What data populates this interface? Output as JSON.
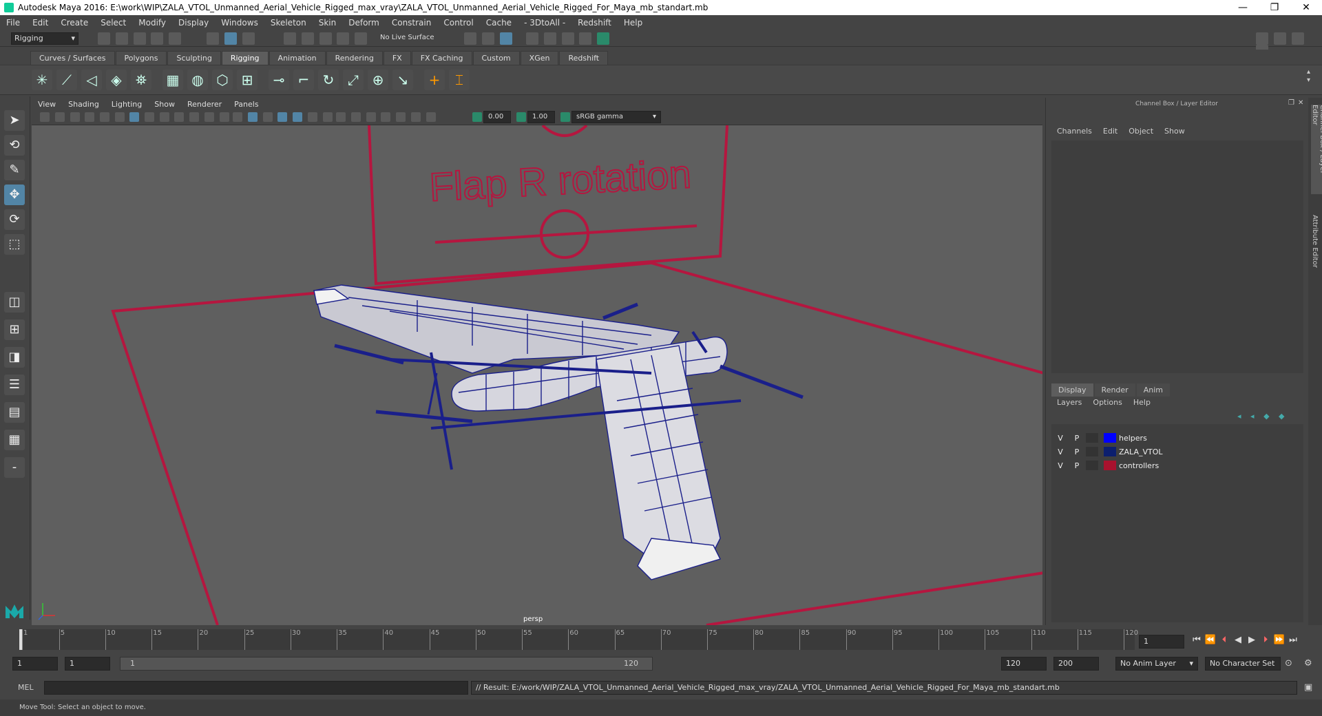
{
  "window": {
    "title": "Autodesk Maya 2016: E:\\work\\WIP\\ZALA_VTOL_Unmanned_Aerial_Vehicle_Rigged_max_vray\\ZALA_VTOL_Unmanned_Aerial_Vehicle_Rigged_For_Maya_mb_standart.mb",
    "controls": [
      "—",
      "❐",
      "✕"
    ]
  },
  "menubar": [
    "File",
    "Edit",
    "Create",
    "Select",
    "Modify",
    "Display",
    "Windows",
    "Skeleton",
    "Skin",
    "Deform",
    "Constrain",
    "Control",
    "Cache",
    "- 3DtoAll -",
    "Redshift",
    "Help"
  ],
  "statusline": {
    "mode": "Rigging",
    "live_surface": "No Live Surface"
  },
  "shelf": {
    "tabs": [
      "Curves / Surfaces",
      "Polygons",
      "Sculpting",
      "Rigging",
      "Animation",
      "Rendering",
      "FX",
      "FX Caching",
      "Custom",
      "XGen",
      "Redshift"
    ],
    "active_tab": "Rigging"
  },
  "panel": {
    "menus": [
      "View",
      "Shading",
      "Lighting",
      "Show",
      "Renderer",
      "Panels"
    ],
    "exposure": "0.00",
    "gamma": "1.00",
    "color_space": "sRGB gamma"
  },
  "viewport": {
    "camera_label": "persp",
    "annotation": "Flap R rotation"
  },
  "channel_box": {
    "title": "Channel Box / Layer Editor",
    "menus": [
      "Channels",
      "Edit",
      "Object",
      "Show"
    ]
  },
  "layer_editor": {
    "tabs": [
      "Display",
      "Render",
      "Anim"
    ],
    "active_tab": "Display",
    "menus": [
      "Layers",
      "Options",
      "Help"
    ],
    "layers": [
      {
        "v": "V",
        "p": "P",
        "color": "#0000ff",
        "name": "helpers"
      },
      {
        "v": "V",
        "p": "P",
        "color": "#0c1f6e",
        "name": "ZALA_VTOL"
      },
      {
        "v": "V",
        "p": "P",
        "color": "#a8122e",
        "name": "controllers"
      }
    ]
  },
  "side_tabs": [
    "Channel Box / Layer Editor",
    "Attribute Editor"
  ],
  "timeline": {
    "ticks": [
      "1",
      "5",
      "10",
      "15",
      "20",
      "25",
      "30",
      "35",
      "40",
      "45",
      "50",
      "55",
      "60",
      "65",
      "70",
      "75",
      "80",
      "85",
      "90",
      "95",
      "100",
      "105",
      "110",
      "115",
      "120"
    ],
    "current_frame": "1"
  },
  "range": {
    "start": "1",
    "playback_start": "1",
    "slider_start": "1",
    "slider_end": "120",
    "playback_end": "120",
    "end": "200",
    "anim_layer": "No Anim Layer",
    "character_set": "No Character Set"
  },
  "command": {
    "lang": "MEL",
    "result": "// Result: E:/work/WIP/ZALA_VTOL_Unmanned_Aerial_Vehicle_Rigged_max_vray/ZALA_VTOL_Unmanned_Aerial_Vehicle_Rigged_For_Maya_mb_standart.mb"
  },
  "help_line": "Move Tool: Select an object to move.",
  "colors": {
    "controller": "#b5163f",
    "wire": "#1a1f8a",
    "accent": "#5285a6"
  }
}
